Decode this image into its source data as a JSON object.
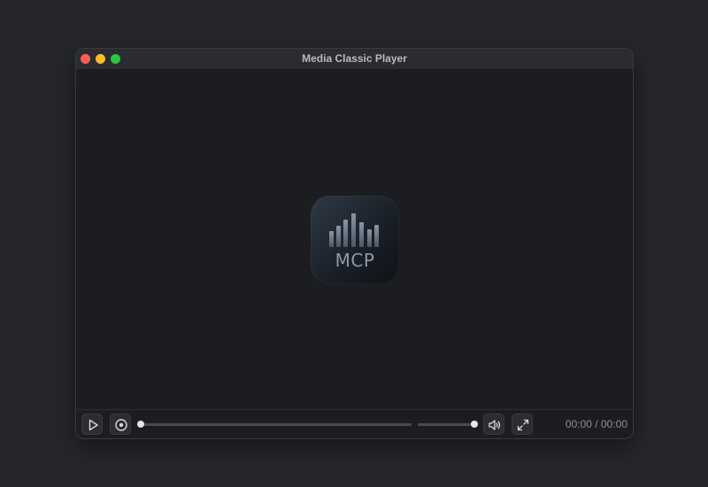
{
  "window": {
    "title": "Media Classic Player"
  },
  "logo": {
    "text": "MCP",
    "icon": "equalizer-bars-icon"
  },
  "controls": {
    "play_icon": "play-icon",
    "stop_icon": "stop-icon",
    "seek_progress": 0,
    "volume_level": 1.0,
    "volume_icon": "speaker-icon",
    "fullscreen_icon": "fullscreen-icon",
    "current_time": "00:00",
    "separator": "/",
    "total_time": "00:00"
  },
  "colors": {
    "traffic_close": "#ff5f57",
    "traffic_minimize": "#febc2e",
    "traffic_zoom": "#28c840",
    "background": "#25272c",
    "window": "#1c1d21"
  }
}
